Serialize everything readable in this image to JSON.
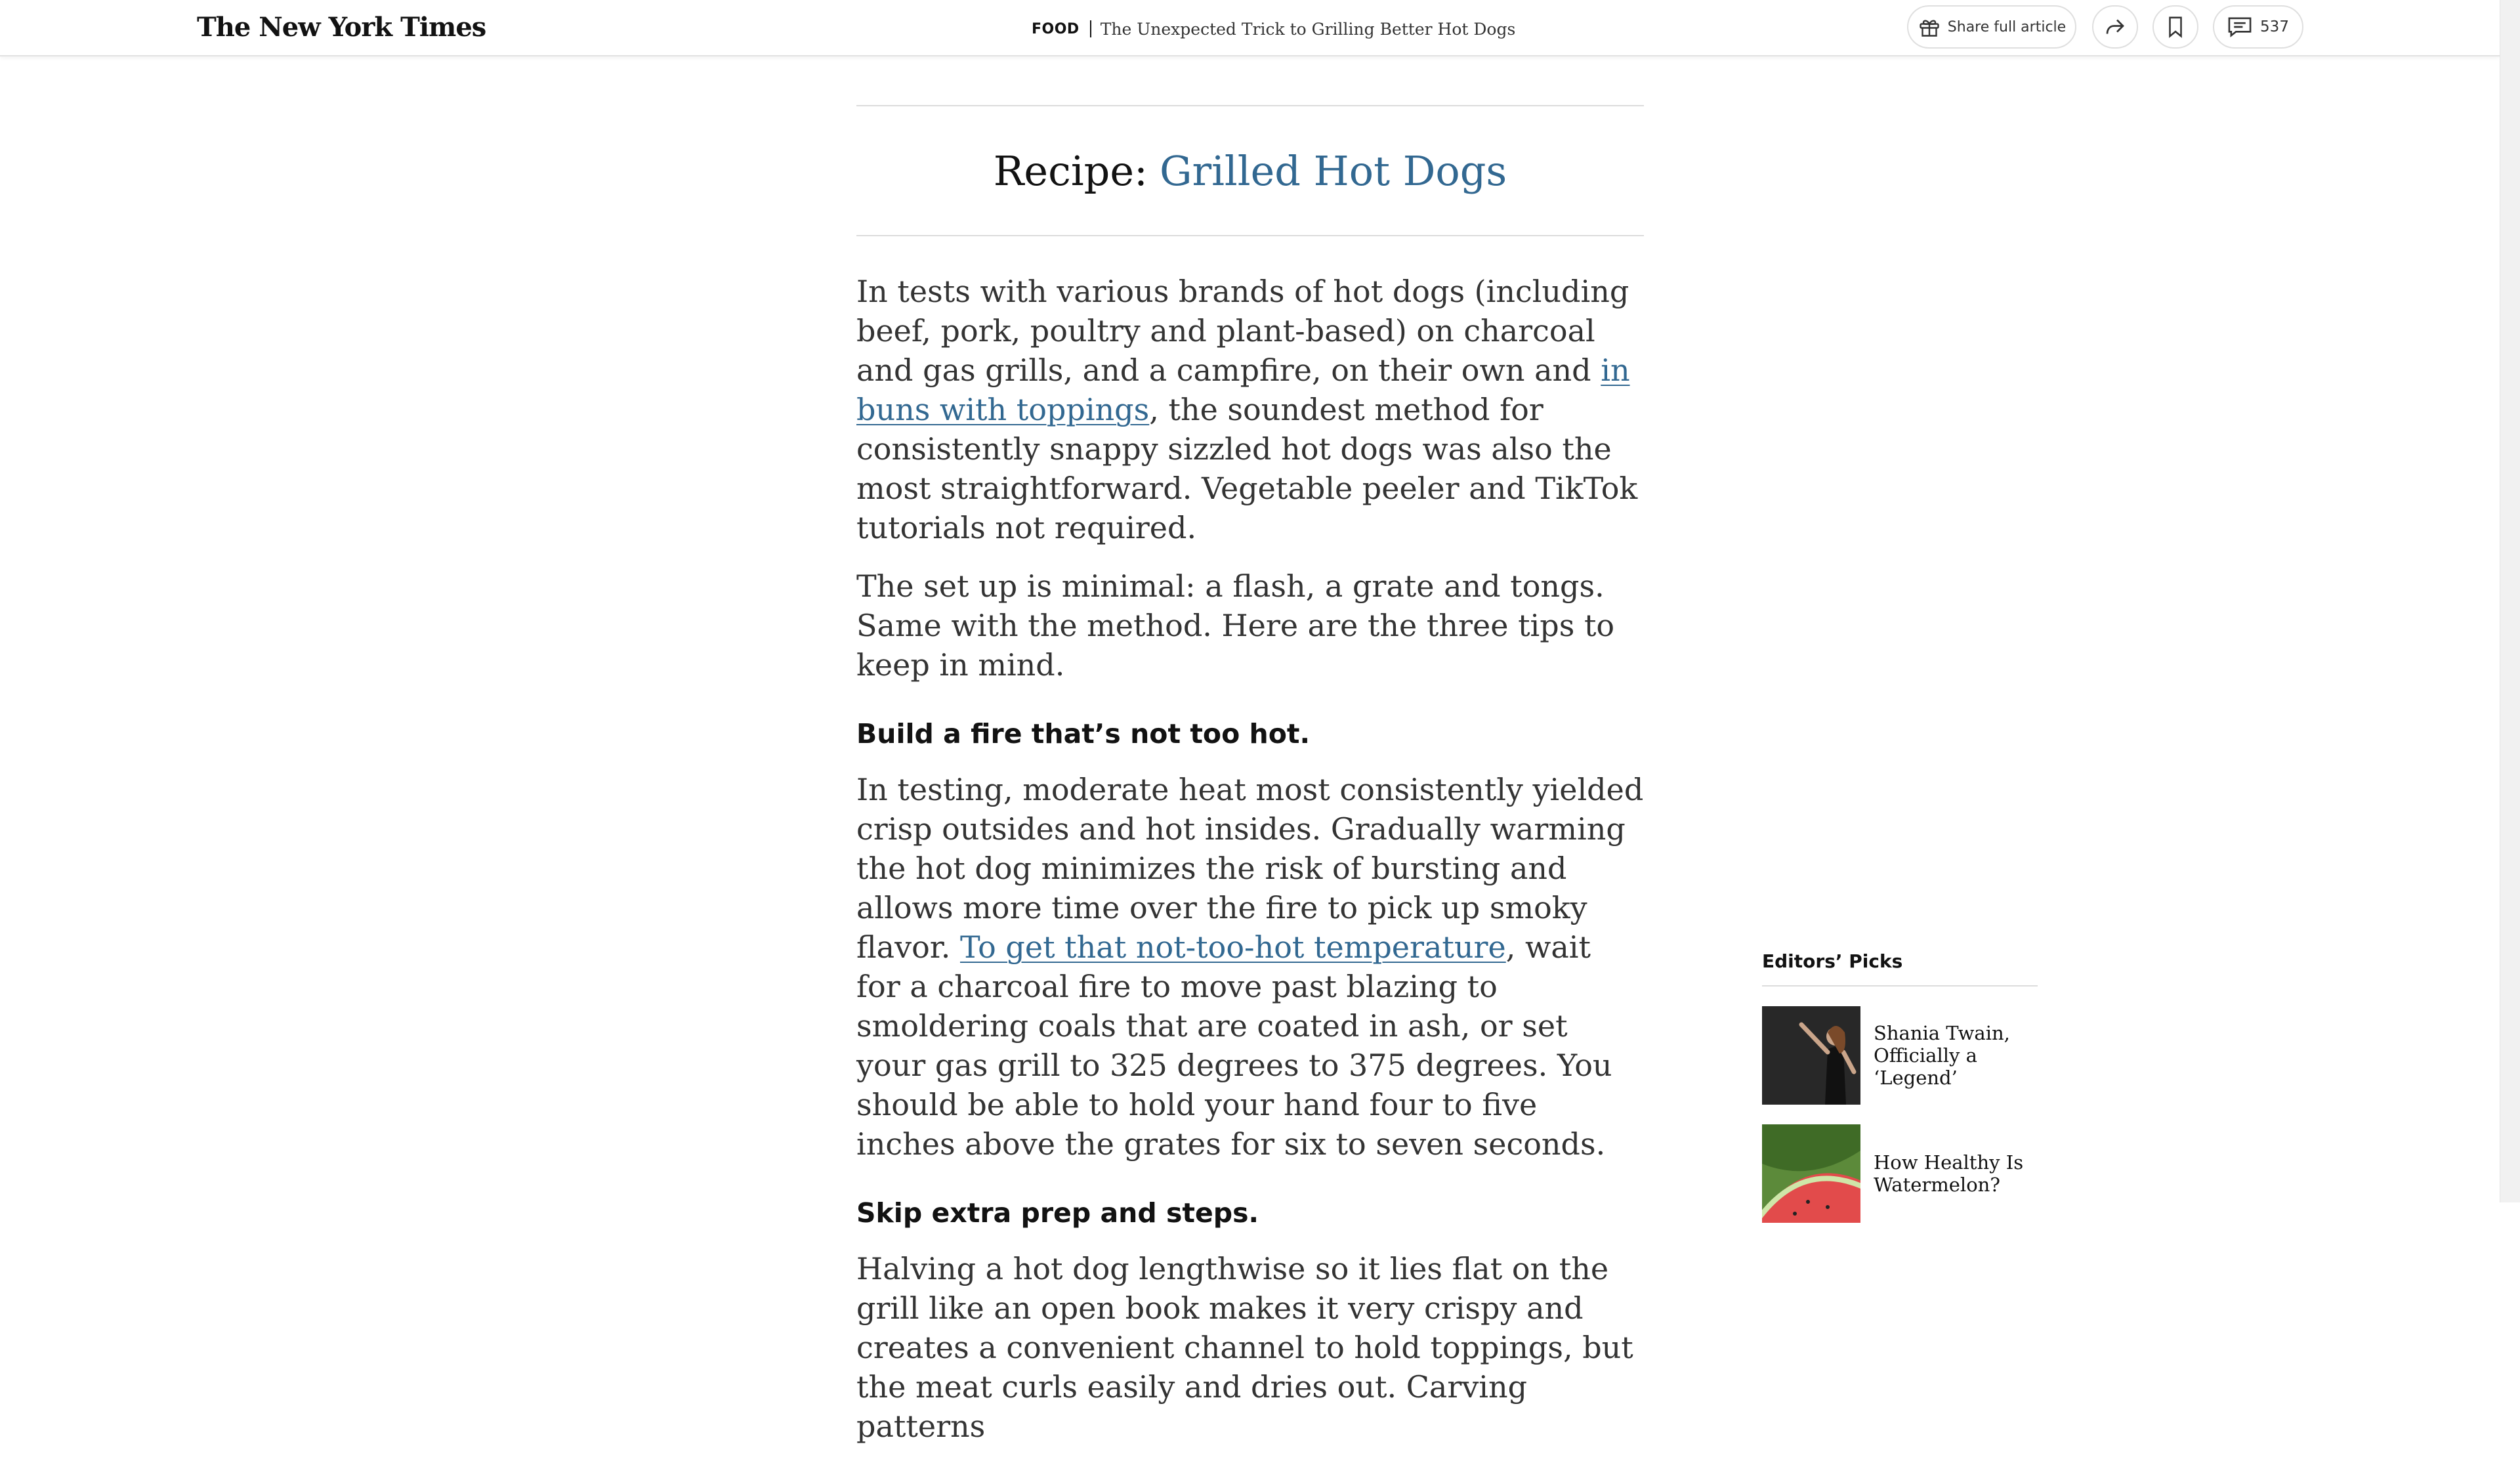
{
  "header": {
    "logo_text": "The New York Times",
    "section": "FOOD",
    "headline": "The Unexpected Trick to Grilling Better Hot Dogs",
    "share_full_article": "Share full article",
    "comment_count": "537",
    "icons": [
      "gift-icon",
      "share-icon",
      "bookmark-icon",
      "comment-icon"
    ]
  },
  "article": {
    "recipe_label": "Recipe:",
    "recipe_link": "Grilled Hot Dogs",
    "p1_a": "In tests with various brands of hot dogs (including beef, pork, poultry and plant-based) on charcoal and gas grills, and a campfire, on their own and ",
    "p1_link": "in buns with toppings",
    "p1_b": ", the soundest method for consistently snappy sizzled hot dogs was also the most straightforward. Vegetable peeler and TikTok tutorials not required.",
    "p2": "The set up is minimal: a flash, a grate and tongs. Same with the method. Here are the three tips to keep in mind.",
    "h1": "Build a fire that’s not too hot.",
    "p3_a": "In testing, moderate heat most consistently yielded crisp outsides and hot insides. Gradually warming the hot dog minimizes the risk of bursting and allows more time over the fire to pick up smoky flavor. ",
    "p3_link": "To get that not-too-hot temperature",
    "p3_b": ", wait for a charcoal fire to move past blazing to smoldering coals that are coated in ash, or set your gas grill to 325 degrees to 375 degrees. You should be able to hold your hand four to five inches above the grates for six to seven seconds.",
    "h2": "Skip extra prep and steps.",
    "p4": "Halving a hot dog lengthwise so it lies flat on the grill like an open book makes it very crispy and creates a convenient channel to hold toppings, but the meat curls easily and dries out. Carving patterns"
  },
  "sidebar": {
    "heading": "Editors’ Picks",
    "picks": [
      {
        "title": "Shania Twain, Officially a ‘Legend’"
      },
      {
        "title": "How Healthy Is Watermelon?"
      }
    ]
  },
  "colors": {
    "link": "#326891",
    "text": "#333333",
    "heading": "#121212",
    "rule": "#dcdcdc"
  }
}
